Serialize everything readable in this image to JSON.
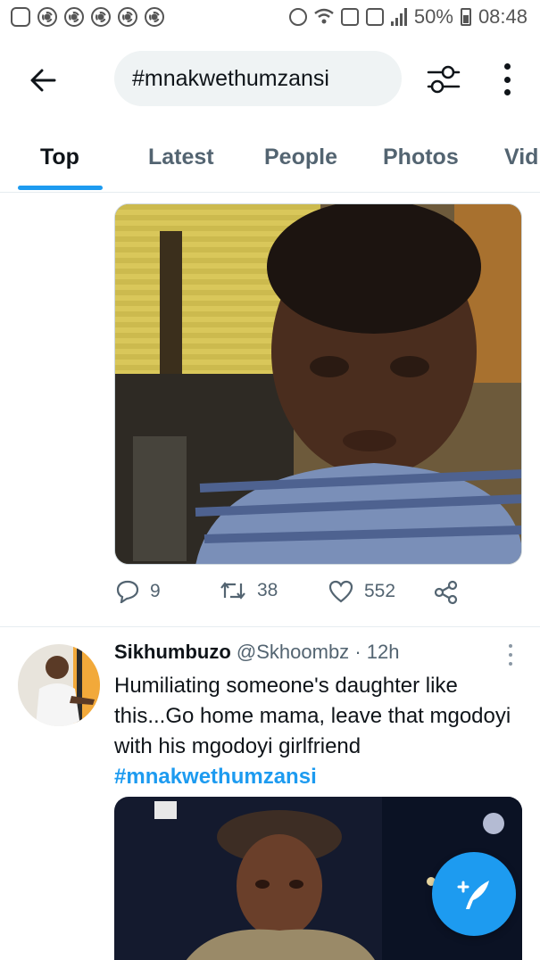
{
  "status_bar": {
    "battery": "50%",
    "time": "08:48",
    "left_icons": [
      "instagram-icon",
      "settings-notif-icon",
      "settings-notif-icon",
      "settings-notif-icon",
      "settings-notif-icon",
      "chrome-icon"
    ],
    "right_icons": [
      "alarm-icon",
      "wifi-icon",
      "call-icon",
      "no-signal-icon",
      "signal-icon",
      "battery-icon"
    ]
  },
  "header": {
    "search_query": "#mnakwethumzansi",
    "back_icon": "arrow-left-icon",
    "filter_icon": "filter-sliders-icon",
    "more_icon": "more-vertical-icon"
  },
  "tabs": [
    {
      "label": "Top",
      "active": true
    },
    {
      "label": "Latest",
      "active": false
    },
    {
      "label": "People",
      "active": false
    },
    {
      "label": "Photos",
      "active": false
    },
    {
      "label": "Vid",
      "active": false
    }
  ],
  "tweet1": {
    "replies": "9",
    "retweets": "38",
    "likes": "552"
  },
  "tweet2": {
    "name": "Sikhumbuzo",
    "handle": "@Skhoombz",
    "sep": "·",
    "time": "12h",
    "text": "Humiliating someone's daughter like this...Go home mama, leave that mgodoyi with his mgodoyi girlfriend",
    "hashtag": "#mnakwethumzansi"
  },
  "colors": {
    "accent": "#1d9bf0",
    "text": "#0f1419",
    "muted": "#536471"
  }
}
